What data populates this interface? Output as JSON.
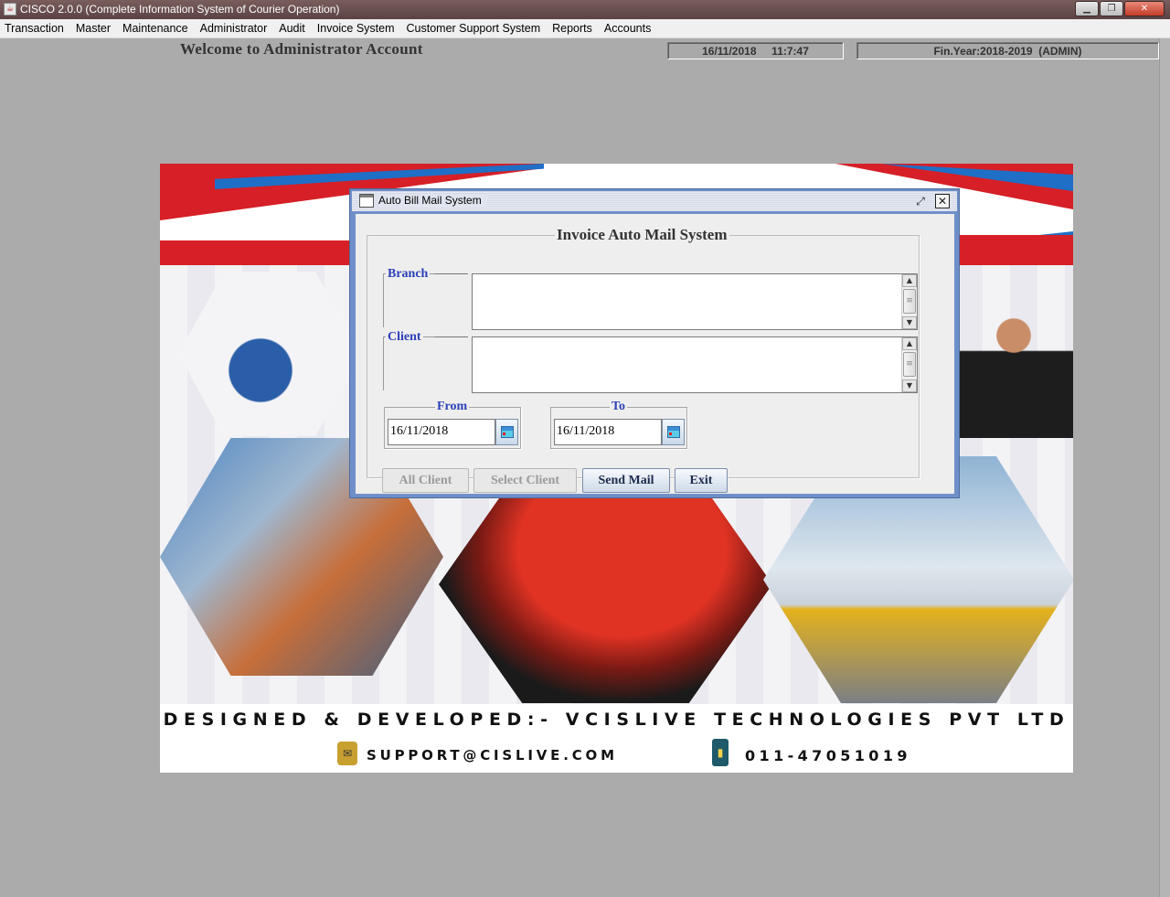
{
  "window": {
    "title": "CISCO 2.0.0 (Complete Information System of Courier Operation)",
    "app_icon": "java-cup-icon",
    "buttons": [
      "minimize",
      "maximize",
      "close"
    ]
  },
  "menu": {
    "items": [
      "Transaction",
      "Master",
      "Maintenance",
      "Administrator",
      "Audit",
      "Invoice System",
      "Customer Support System",
      "Reports",
      "Accounts"
    ]
  },
  "header": {
    "welcome": "Welcome to Administrator Account",
    "datetime": "16/11/2018     11:7:47",
    "fin_year": "Fin.Year:2018-2019  (ADMIN)"
  },
  "banner": {
    "credit": "DESIGNED & DEVELOPED:- VCISLIVE TECHNOLOGIES PVT LTD",
    "email": "SUPPORT@CISLIVE.COM",
    "phone": "011-47051019",
    "colors": {
      "red": "#d61f26",
      "blue": "#1f6fc7"
    }
  },
  "dialog": {
    "title": "Auto Bill Mail System",
    "heading": "Invoice Auto Mail System",
    "branch_label": "Branch",
    "client_label": "Client",
    "from_label": "From",
    "to_label": "To",
    "from_date": "16/11/2018",
    "to_date": "16/11/2018",
    "buttons": {
      "all_client": "All Client",
      "select_client": "Select Client",
      "send_mail": "Send Mail",
      "exit": "Exit"
    },
    "colors": {
      "frame": "#6f8fc8",
      "label_blue": "#2b3fb8"
    }
  }
}
